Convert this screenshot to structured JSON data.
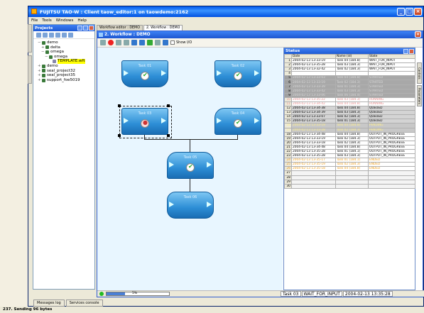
{
  "window": {
    "title": "FUJITSU TAO-W : Client taow_editor:1 on taowdemo:2162"
  },
  "menu": [
    "File",
    "Tools",
    "Windows",
    "Help"
  ],
  "projects": {
    "title": "Projects",
    "tree": [
      {
        "label": "demo",
        "level": 0,
        "twisty": "−",
        "kind": "folder"
      },
      {
        "label": "delta",
        "level": 1,
        "twisty": "+",
        "kind": "folder"
      },
      {
        "label": "omega",
        "level": 1,
        "twisty": "−",
        "kind": "folder"
      },
      {
        "label": "omega",
        "level": 2,
        "twisty": "−",
        "kind": "folder"
      },
      {
        "label": "TEMPLATE.wft",
        "level": 3,
        "twisty": "",
        "kind": "file",
        "highlight": true
      },
      {
        "label": "demo",
        "level": 0,
        "twisty": "+",
        "kind": "folder"
      },
      {
        "label": "seal_project32",
        "level": 0,
        "twisty": "+",
        "kind": "folder"
      },
      {
        "label": "seal_project35",
        "level": 0,
        "twisty": "+",
        "kind": "folder"
      },
      {
        "label": "support_foe5019",
        "level": 0,
        "twisty": "+",
        "kind": "folder"
      }
    ],
    "side_tabs": [
      "Projects",
      "Workflows"
    ]
  },
  "editor_tabs": [
    {
      "label": "Workflow editor : DEMO",
      "active": false
    },
    {
      "label": "2. Workflow : DEMO",
      "active": true
    }
  ],
  "workflow": {
    "title": "2. Workflow : DEMO",
    "show_io_label": "Show I/O",
    "tasks": [
      {
        "label": "Task 01",
        "state": "ok"
      },
      {
        "label": "Task 02",
        "state": "ok"
      },
      {
        "label": "Task 03",
        "state": "run"
      },
      {
        "label": "Task 04",
        "state": "ok"
      },
      {
        "label": "Task 05",
        "state": "ok"
      },
      {
        "label": "Task 06",
        "state": "none"
      }
    ],
    "progress": {
      "value": 0.3,
      "label": "5%"
    }
  },
  "status": {
    "title": "Status",
    "columns": [
      "",
      "Date",
      "Name (id)",
      "State"
    ],
    "rows": [
      {
        "n": "1",
        "date": "2004-02-13 13-33-19",
        "name": "Task 04 (184.8)",
        "state": "WAIT_FOR_INPUT",
        "style": "white"
      },
      {
        "n": "2",
        "date": "2004-02-13 13-35-28",
        "name": "Task 03 (184.3)",
        "state": "WAIT_FOR_INPUT",
        "style": "white"
      },
      {
        "n": "3",
        "date": "2004-02-13 13-32-42",
        "name": "Task 02 (184.3)",
        "state": "WAIT_FOR_INPUT",
        "style": "white"
      },
      {
        "n": "4",
        "date": "",
        "name": "",
        "state": "",
        "style": "white"
      },
      {
        "n": "5",
        "date": "2004-02-13 13-33-03",
        "name": "Task 04 (184.8)",
        "state": "STARTED",
        "style": "gray"
      },
      {
        "n": "6",
        "date": "2004-02-13 13-33-19",
        "name": "Task 02 (184.3)",
        "state": "STARTED",
        "style": "gray"
      },
      {
        "n": "7",
        "date": "2004-02-13 13-33-39",
        "name": "Task 01 (184.3)",
        "state": "STARTED",
        "style": "gray"
      },
      {
        "n": "8",
        "date": "2004-02-13 13-33-42",
        "name": "Task 03 (184.3)",
        "state": "STARTED",
        "style": "gray"
      },
      {
        "n": "9",
        "date": "2004-02-13 13-33-06",
        "name": "Task 06 (184.4)",
        "state": "STARTED",
        "style": "gray"
      },
      {
        "n": "10",
        "date": "2004-02-13 13-35-22",
        "name": "Task 03 (184.3)",
        "state": "RUNNING",
        "style": "pink"
      },
      {
        "n": "11",
        "date": "2004-02-13 13-34-42",
        "name": "Task 04 (184.8)",
        "state": "RUNNING",
        "style": "pink"
      },
      {
        "n": "12",
        "date": "2004-02-13 13-34-38",
        "name": "Task 04 (184.8)",
        "state": "QUEUED",
        "style": "queued"
      },
      {
        "n": "13",
        "date": "2004-02-13 13-34-39",
        "name": "Task 03 (184.3)",
        "state": "QUEUED",
        "style": "queued"
      },
      {
        "n": "14",
        "date": "2004-02-13 13-33-07",
        "name": "Task 02 (184.3)",
        "state": "QUEUED",
        "style": "queued"
      },
      {
        "n": "15",
        "date": "2004-02-13 13-35-18",
        "name": "Task 01 (184.3)",
        "state": "QUEUED",
        "style": "queued"
      },
      {
        "n": "16",
        "date": "2004-02-13 13-33-19",
        "name": "Task 04 (184.8)",
        "state": "PENDING",
        "style": "yellow"
      },
      {
        "n": "17",
        "date": "2004-02-13 13-33-28",
        "name": "Task 02 (184.3)",
        "state": "PENDING",
        "style": "yellow"
      },
      {
        "n": "18",
        "date": "2004-02-13 13-34-48",
        "name": "Task 04 (184.8)",
        "state": "OUTPUT_IN_PROGRESS",
        "style": "out"
      },
      {
        "n": "19",
        "date": "2004-02-13 13-33-19",
        "name": "Task 02 (184.3)",
        "state": "OUTPUT_IN_PROGRESS",
        "style": "out"
      },
      {
        "n": "20",
        "date": "2004-02-13 13-33-18",
        "name": "Task 02 (184.3)",
        "state": "OUTPUT_IN_PROGRESS",
        "style": "out"
      },
      {
        "n": "21",
        "date": "2004-02-13 13-34-48",
        "name": "Task 04 (184.8)",
        "state": "OUTPUT_IN_PROGRESS",
        "style": "out"
      },
      {
        "n": "22",
        "date": "2004-02-13 13-35-28",
        "name": "Task 01 (184.1)",
        "state": "OUTPUT_IN_PROGRESS",
        "style": "out"
      },
      {
        "n": "23",
        "date": "2004-02-13 13-35-28",
        "name": "Task 03 (184.3)",
        "state": "OUTPUT_IN_PROGRESS",
        "style": "out"
      },
      {
        "n": "24",
        "date": "2004-02-13 13-35-17",
        "name": "Task 01 (184.1)",
        "state": "ENDED",
        "style": "ended"
      },
      {
        "n": "25",
        "date": "2004-02-13 13-35-19",
        "name": "Task 02 (184.3)",
        "state": "ENDED",
        "style": "ended"
      },
      {
        "n": "26",
        "date": "2004-02-13 13-35-18",
        "name": "Task 04 (184.8)",
        "state": "ENDED",
        "style": "ended"
      },
      {
        "n": "27",
        "date": "",
        "name": "",
        "state": "",
        "style": "empty"
      },
      {
        "n": "28",
        "date": "",
        "name": "",
        "state": "",
        "style": "empty"
      },
      {
        "n": "29",
        "date": "",
        "name": "",
        "state": "",
        "style": "empty"
      },
      {
        "n": "30",
        "date": "",
        "name": "",
        "state": "",
        "style": "empty"
      }
    ],
    "right_tabs": [
      "Controls",
      "Parameters"
    ],
    "footer": {
      "task": "Task 03",
      "state": "WAIT_FOR_INPUT",
      "date": "2004-02-13 13:35:28"
    }
  },
  "bottom_tabs": [
    "Messages log",
    "Services console"
  ],
  "status_line": "237. Sending 96 bytes"
}
